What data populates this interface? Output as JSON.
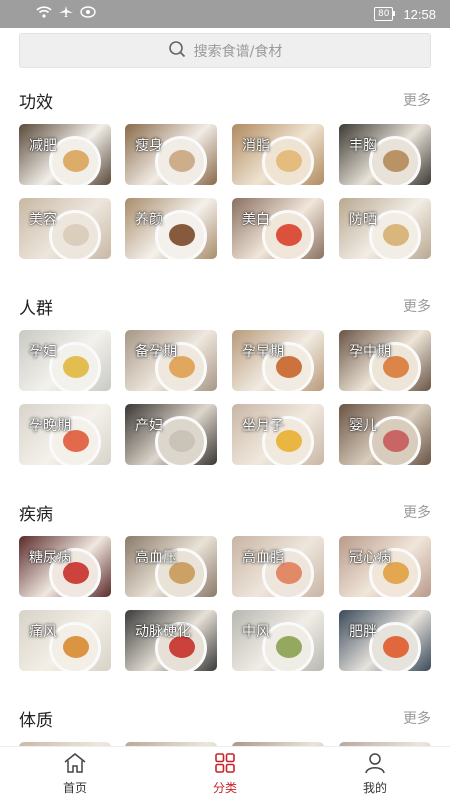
{
  "status_bar": {
    "time": "12:58",
    "battery": "80"
  },
  "search": {
    "placeholder": "搜索食谱/食材"
  },
  "sections": [
    {
      "title": "功效",
      "more": "更多",
      "items": [
        {
          "label": "减肥",
          "colors": [
            "#5a4a3a",
            "#f2efe9",
            "#d9a45a"
          ]
        },
        {
          "label": "瘦身",
          "colors": [
            "#8a6a4a",
            "#f1ece6",
            "#c9a680"
          ]
        },
        {
          "label": "消脂",
          "colors": [
            "#b08a60",
            "#efe4d2",
            "#e2b774"
          ]
        },
        {
          "label": "丰胸",
          "colors": [
            "#3d3a34",
            "#e8e2d8",
            "#b48a5a"
          ]
        },
        {
          "label": "美容",
          "colors": [
            "#c8b8a4",
            "#ede6dc",
            "#d8cbb9"
          ]
        },
        {
          "label": "养颜",
          "colors": [
            "#a88c6a",
            "#f4f1ec",
            "#7a4a2a"
          ]
        },
        {
          "label": "美白",
          "colors": [
            "#8a7060",
            "#f1e6da",
            "#d8402a"
          ]
        },
        {
          "label": "防晒",
          "colors": [
            "#b8a890",
            "#f2ede5",
            "#d6b070"
          ]
        }
      ]
    },
    {
      "title": "人群",
      "more": "更多",
      "items": [
        {
          "label": "孕妇",
          "colors": [
            "#c9c9c4",
            "#f3f1ec",
            "#e0b840"
          ]
        },
        {
          "label": "备孕期",
          "colors": [
            "#a69686",
            "#efe8de",
            "#e0a050"
          ]
        },
        {
          "label": "孕早期",
          "colors": [
            "#b89a7a",
            "#f1ebe2",
            "#c8652a"
          ]
        },
        {
          "label": "孕中期",
          "colors": [
            "#6a5444",
            "#ede5d8",
            "#d87a3a"
          ]
        },
        {
          "label": "孕晚期",
          "colors": [
            "#d8d4cc",
            "#f4f1ea",
            "#e05a3a"
          ]
        },
        {
          "label": "产妇",
          "colors": [
            "#3a3632",
            "#ddd6cc",
            "#c8c2b6"
          ]
        },
        {
          "label": "坐月子",
          "colors": [
            "#c8b6a6",
            "#f1e9de",
            "#e8b030"
          ]
        },
        {
          "label": "婴儿",
          "colors": [
            "#6a5444",
            "#d8ccbc",
            "#c85a5a"
          ]
        }
      ]
    },
    {
      "title": "疾病",
      "more": "更多",
      "items": [
        {
          "label": "糖尿病",
          "colors": [
            "#5a2a2a",
            "#f0e8e0",
            "#c8302a"
          ]
        },
        {
          "label": "高血压",
          "colors": [
            "#8a7a6a",
            "#e9e2d6",
            "#c89a5a"
          ]
        },
        {
          "label": "高血脂",
          "colors": [
            "#c8b4a4",
            "#eee6dc",
            "#e0805a"
          ]
        },
        {
          "label": "冠心病",
          "colors": [
            "#b89a8a",
            "#f0e6da",
            "#e0a040"
          ]
        },
        {
          "label": "痛风",
          "colors": [
            "#d8d2c8",
            "#f3efe6",
            "#d88a30"
          ]
        },
        {
          "label": "动脉硬化",
          "colors": [
            "#3a3a3a",
            "#e6e0d6",
            "#c8302a"
          ]
        },
        {
          "label": "中风",
          "colors": [
            "#b8b8b0",
            "#f0ede6",
            "#8aa050"
          ]
        },
        {
          "label": "肥胖",
          "colors": [
            "#3a4a5a",
            "#e6e2dc",
            "#e05a2a"
          ]
        }
      ]
    },
    {
      "title": "体质",
      "more": "更多",
      "items": [
        {
          "label": "",
          "colors": [
            "#c8b8a8",
            "#efe8de",
            "#d8a060"
          ]
        },
        {
          "label": "",
          "colors": [
            "#b8a898",
            "#ece6dc",
            "#c88a50"
          ]
        },
        {
          "label": "",
          "colors": [
            "#a89888",
            "#ebe4da",
            "#d89a60"
          ]
        },
        {
          "label": "",
          "colors": [
            "#b8a8a0",
            "#ede6dc",
            "#c8804a"
          ]
        }
      ]
    }
  ],
  "tabs": [
    {
      "label": "首页",
      "icon": "home-icon"
    },
    {
      "label": "分类",
      "icon": "category-icon",
      "active": true
    },
    {
      "label": "我的",
      "icon": "profile-icon"
    }
  ],
  "accent_color": "#c8232c"
}
